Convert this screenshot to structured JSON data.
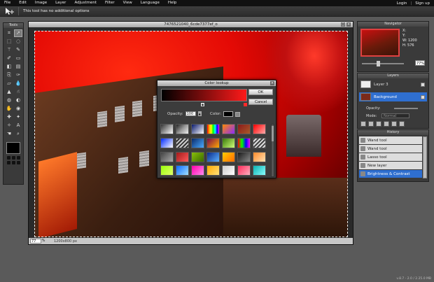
{
  "menu": {
    "items": [
      "File",
      "Edit",
      "Image",
      "Layer",
      "Adjustment",
      "Filter",
      "View",
      "Language",
      "Help"
    ],
    "login": "Login",
    "separator": "|",
    "signup": "Sign up"
  },
  "options_bar": {
    "tool_icon": "move-tool-icon",
    "message": "This tool has no additional options"
  },
  "tools_panel": {
    "title": "Tools",
    "tools": [
      "crop-icon",
      "move-icon",
      "marquee-icon",
      "lasso-icon",
      "wand-icon",
      "pencil-icon",
      "brush-icon",
      "eraser-icon",
      "fill-icon",
      "gradient-icon",
      "clone-icon",
      "color-replace-icon",
      "drawing-icon",
      "blur-icon",
      "sharpen-icon",
      "smudge-icon",
      "sponge-icon",
      "dodge-icon",
      "burn-icon",
      "red-eye-icon",
      "spot-heal-icon",
      "bloat-icon",
      "pinch-icon",
      "text-icon",
      "hand-icon",
      "zoom-icon"
    ],
    "foreground_color": "#000000"
  },
  "document": {
    "title": "7476521040_6cde7377ef_o",
    "zoom": "77",
    "zoom_unit": "%",
    "size": "1200x800 px"
  },
  "dialog": {
    "title": "Color lookup",
    "ok_label": "OK",
    "cancel_label": "Cancel",
    "opacity_label": "Opacity:",
    "opacity_value": "100",
    "color_label": "Color:",
    "gradient_start": "#000000",
    "gradient_end": "#ff1a1a",
    "swatches": [
      "linear-gradient(135deg,#333,#fff)",
      "linear-gradient(135deg,#222,#999 50%,#eee)",
      "linear-gradient(135deg,#0a1a6a,#fff)",
      "linear-gradient(90deg,red,orange,yellow,lime,cyan,blue,magenta)",
      "linear-gradient(135deg,#ff8a00,#8a2aff)",
      "linear-gradient(135deg,#8a1a1a,#aa5a2a)",
      "linear-gradient(135deg,#ff0000,#ffaaaa)",
      "linear-gradient(135deg,#002aff,#fff)",
      "repeating-linear-gradient(135deg,#ccc 0 2px,#333 2px 4px)",
      "linear-gradient(135deg,#0a2a6a,#4aaaff)",
      "linear-gradient(135deg,#7a0a4a,#ffaa00)",
      "linear-gradient(135deg,#3a7a0a,#cfff7a)",
      "linear-gradient(90deg,red,lime,blue,magenta)",
      "repeating-linear-gradient(135deg,#444 0 2px,#ddd 2px 4px)",
      "linear-gradient(135deg,#444,#aaa)",
      "linear-gradient(135deg,#a21a1a,#ff5a5a)",
      "linear-gradient(135deg,#8ac00a,#3a6a00)",
      "linear-gradient(135deg,#0a2a8a,#5ab0ff)",
      "linear-gradient(135deg,#ffcc00,#ff6a00)",
      "linear-gradient(135deg,#1a1a1a,#888)",
      "linear-gradient(135deg,#ff8a2a,#ffe0b0)",
      "linear-gradient(135deg,#9aff0a,#e0ff6a)",
      "linear-gradient(135deg,#0a6aff,#a0e0ff)",
      "linear-gradient(135deg,#ff00aa,#ff8aee)",
      "linear-gradient(135deg,#ffaa00,#ffe07a)",
      "linear-gradient(135deg,#cccccc,#ffffff)",
      "linear-gradient(135deg,#ff2a5a,#ffb0c0)",
      "linear-gradient(135deg,#0ab0b0,#8affff)"
    ]
  },
  "navigator": {
    "title": "Navigator",
    "x_label": "X:",
    "y_label": "Y:",
    "w_label": "W:",
    "w_value": "1200",
    "h_label": "H:",
    "h_value": "576",
    "zoom": "77",
    "zoom_unit": "%"
  },
  "layers": {
    "title": "Layers",
    "items": [
      {
        "name": "Layer 3",
        "selected": false
      },
      {
        "name": "Background",
        "selected": true
      }
    ],
    "opacity_label": "Opacity:",
    "mode_label": "Mode:",
    "mode_value": "Normal"
  },
  "history": {
    "title": "History",
    "items": [
      {
        "name": "Wand tool",
        "selected": false
      },
      {
        "name": "Wand tool",
        "selected": false
      },
      {
        "name": "Lasso tool",
        "selected": false
      },
      {
        "name": "New layer",
        "selected": false
      },
      {
        "name": "Brightness & Contrast",
        "selected": true
      }
    ]
  },
  "footer": {
    "version": "v.8.7 - 2.0 / 2.25.0 MB"
  },
  "colors": {
    "selection_blue": "#2f6fd0",
    "menu_bg": "#111111",
    "workspace_bg": "#5a5a5a"
  }
}
